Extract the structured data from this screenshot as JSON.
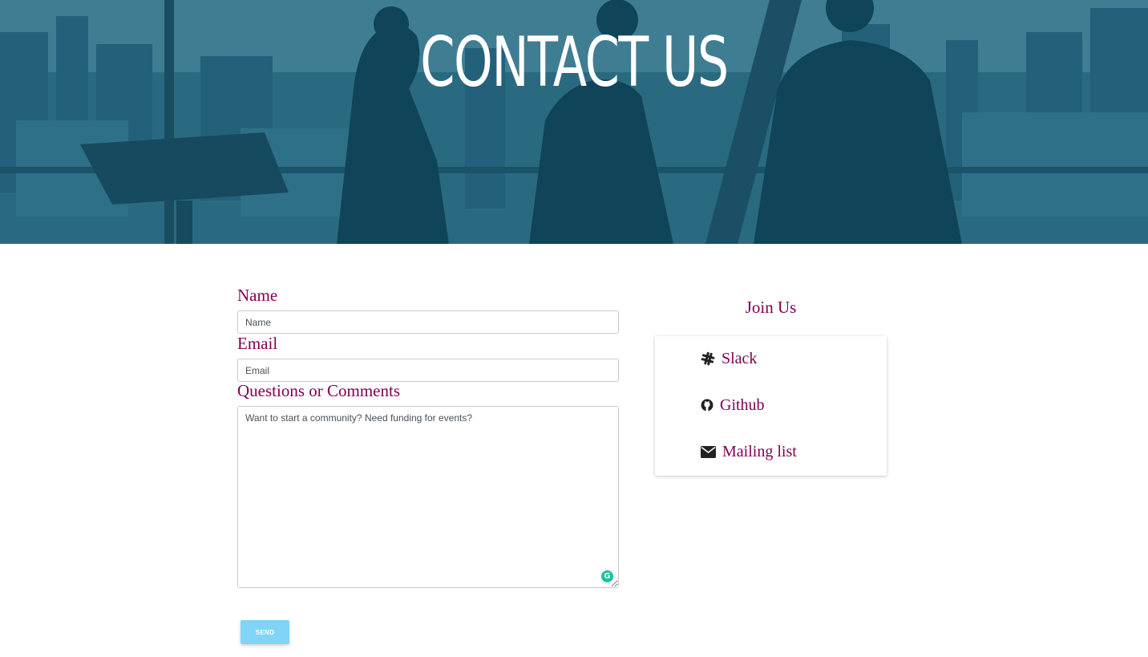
{
  "hero": {
    "title": "CONTACT US"
  },
  "form": {
    "name_label": "Name",
    "name_placeholder": "Name",
    "email_label": "Email",
    "email_placeholder": "Email",
    "comments_label": "Questions or Comments",
    "comments_placeholder": "Want to start a community? Need funding for events?",
    "send_label": "SEND"
  },
  "join": {
    "title": "Join Us",
    "links": [
      {
        "label": "Slack",
        "icon": "slack-icon"
      },
      {
        "label": "Github",
        "icon": "github-icon"
      },
      {
        "label": "Mailing list",
        "icon": "envelope-icon"
      }
    ]
  },
  "colors": {
    "label_color": "#800052",
    "hero_overlay": "#1d5a70",
    "send_button": "#80d4f5"
  }
}
